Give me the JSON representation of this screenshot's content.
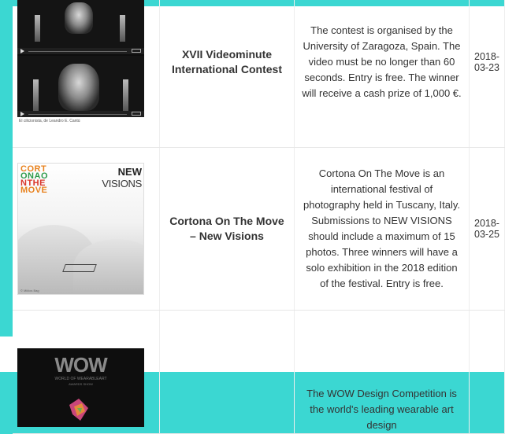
{
  "rows": [
    {
      "title": "XVII Videominute International Contest",
      "description": "The contest is organised by the University of Zaragoza, Spain. The video must be no longer than 60 seconds. Entry is free. The winner will receive a cash prize of 1,000 €.",
      "date": "2018-03-23",
      "image": {
        "caption": "El cilicionista, de Leandro E. Cantú"
      }
    },
    {
      "title": "Cortona On The Move – New Visions",
      "description": "Cortona On The Move is an international festival of photography held in Tuscany, Italy. Submissions to NEW VISIONS should include a maximum of 15 photos. Three winners will have a solo exhibition in the 2018 edition of the festival. Entry is free.",
      "date": "2018-03-25",
      "image": {
        "logo_lines": [
          "CORT",
          "ONAO",
          "NTHE",
          "MOVE"
        ],
        "new_line1": "NEW",
        "new_line2": "VISIONS",
        "credit": "© Miklos Bag"
      }
    },
    {
      "title": "",
      "description": "The WOW Design Competition is the world's leading wearable art design",
      "date": "",
      "image": {
        "logo": "WOW",
        "sub1": "WORLD OF WEARABLEART",
        "sub2": "AWARDS SHOW"
      }
    }
  ],
  "colors": {
    "background": "#3bd7d2",
    "panel": "#ffffff"
  }
}
